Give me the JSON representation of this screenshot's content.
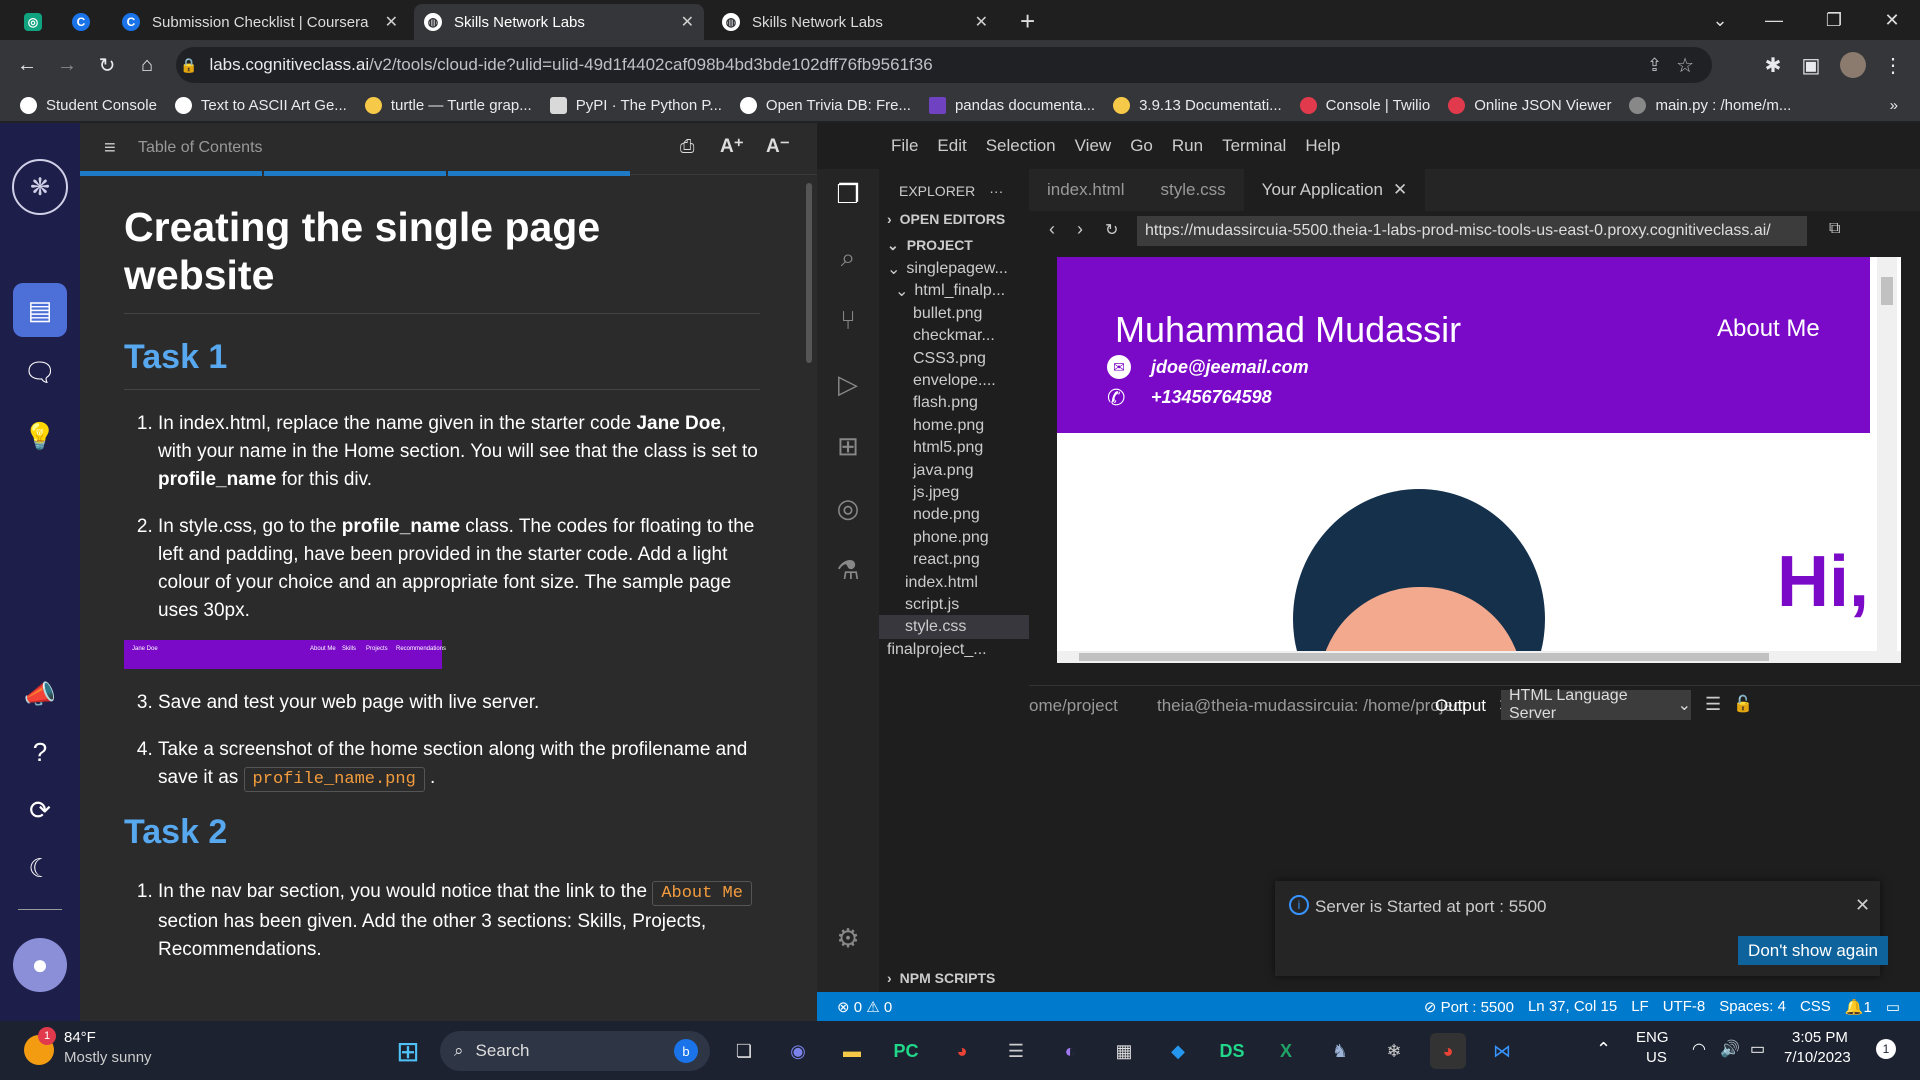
{
  "browser": {
    "tabs": [
      {
        "title": ""
      },
      {
        "title": ""
      },
      {
        "title": "Submission Checklist | Coursera"
      },
      {
        "title": "Skills Network Labs"
      },
      {
        "title": "Skills Network Labs"
      }
    ],
    "new_tab": "+",
    "url_host": "labs.cognitiveclass.ai",
    "url_path": "/v2/tools/cloud-ide?ulid=ulid-49d1f4402caf098b4bd3bde102dff76fb9561f36",
    "bookmarks": [
      {
        "label": "Student Console",
        "color": "#ffffff"
      },
      {
        "label": "Text to ASCII Art Ge...",
        "color": "#ffffff"
      },
      {
        "label": "turtle — Turtle grap...",
        "color": "#f7c948"
      },
      {
        "label": "PyPI · The Python P...",
        "color": "#d9d9d9"
      },
      {
        "label": "Open Trivia DB: Fre...",
        "color": "#ffffff"
      },
      {
        "label": "pandas documenta...",
        "color": "#6f42c1"
      },
      {
        "label": "3.9.13 Documentati...",
        "color": "#f7c948"
      },
      {
        "label": "Console | Twilio",
        "color": "#e23a4d"
      },
      {
        "label": "Online JSON Viewer",
        "color": "#e23a4d"
      },
      {
        "label": "main.py : /home/m...",
        "color": "#888888"
      }
    ],
    "more_bookmarks": "»"
  },
  "doc": {
    "toc_label": "Table of Contents",
    "title": "Creating the single page website",
    "task1_heading": "Task 1",
    "task1_items": [
      {
        "pre": "In index.html, replace the name given in the starter code ",
        "bold": "Jane Doe",
        "post": ", with your name in the Home section. You will see that the class is set to ",
        "bold2": "profile_name",
        "post2": " for this div."
      },
      {
        "pre": "In style.css, go to the ",
        "bold": "profile_name",
        "post": " class. The codes for floating to the left and padding, have been provided in the starter code. Add a light colour of your choice and an appropriate font size. The sample page uses 30px."
      },
      {
        "text": "Save and test your web page with live server."
      },
      {
        "pre": "Take a screenshot of the home section along with the profilename and save it as ",
        "code": "profile_name.png",
        "post": " ."
      }
    ],
    "thumb": {
      "name": "Jane Doe",
      "nav": [
        "About Me",
        "Skills",
        "Projects",
        "Recommendations"
      ]
    },
    "task2_heading": "Task 2",
    "task2_items": [
      {
        "pre": "In the nav bar section, you would notice that the link to the ",
        "code": "About Me",
        "post": " section has been given. Add the other 3 sections: Skills, Projects, Recommendations."
      }
    ]
  },
  "ide": {
    "menu": [
      "File",
      "Edit",
      "Selection",
      "View",
      "Go",
      "Run",
      "Terminal",
      "Help"
    ],
    "explorer_title": "EXPLORER",
    "explorer_more": "···",
    "open_editors": "OPEN EDITORS",
    "project": "PROJECT",
    "tree": [
      {
        "label": "singlepagew...",
        "indent": 1,
        "chev": "⌄"
      },
      {
        "label": "html_finalp...",
        "indent": 2,
        "chev": "⌄"
      },
      {
        "label": "bullet.png",
        "indent": 3
      },
      {
        "label": "checkmar...",
        "indent": 3
      },
      {
        "label": "CSS3.png",
        "indent": 3
      },
      {
        "label": "envelope....",
        "indent": 3
      },
      {
        "label": "flash.png",
        "indent": 3
      },
      {
        "label": "home.png",
        "indent": 3
      },
      {
        "label": "html5.png",
        "indent": 3
      },
      {
        "label": "java.png",
        "indent": 3
      },
      {
        "label": "js.jpeg",
        "indent": 3
      },
      {
        "label": "node.png",
        "indent": 3
      },
      {
        "label": "phone.png",
        "indent": 3
      },
      {
        "label": "react.png",
        "indent": 3
      },
      {
        "label": "index.html",
        "indent": 2
      },
      {
        "label": "script.js",
        "indent": 2
      },
      {
        "label": "style.css",
        "indent": 2,
        "selected": true
      },
      {
        "label": "finalproject_...",
        "indent": 1
      }
    ],
    "npm_scripts": "NPM SCRIPTS",
    "editor_tabs": [
      {
        "label": "index.html"
      },
      {
        "label": "style.css"
      },
      {
        "label": "Your Application",
        "active": true
      }
    ],
    "preview_url": "https://mudassircuia-5500.theia-1-labs-prod-misc-tools-us-east-0.proxy.cognitiveclass.ai/",
    "preview": {
      "name": "Muhammad Mudassir",
      "email": "jdoe@jeemail.com",
      "phone": "+13456764598",
      "nav_link": "About Me",
      "hi_text": "Hi,"
    },
    "panel_tabs": [
      {
        "label": "ome/project"
      },
      {
        "label": "theia@theia-mudassircuia: /home/project"
      },
      {
        "label": "Output",
        "active": true
      }
    ],
    "output_channel": "HTML Language Server",
    "status": {
      "problems": "⊗ 0 ⚠ 0",
      "port": "Port : 5500",
      "position": "Ln 37, Col 15",
      "eol": "LF",
      "encoding": "UTF-8",
      "spaces": "Spaces: 4",
      "language": "CSS",
      "notifications": "1"
    },
    "toast": {
      "message": "Server is Started at port : 5500",
      "button": "Don't show again"
    }
  },
  "taskbar": {
    "weather_temp": "84°F",
    "weather_desc": "Mostly sunny",
    "weather_badge": "1",
    "search": "Search",
    "lang_line1": "ENG",
    "lang_line2": "US",
    "time": "3:05 PM",
    "date": "7/10/2023",
    "notif_count": "1"
  }
}
